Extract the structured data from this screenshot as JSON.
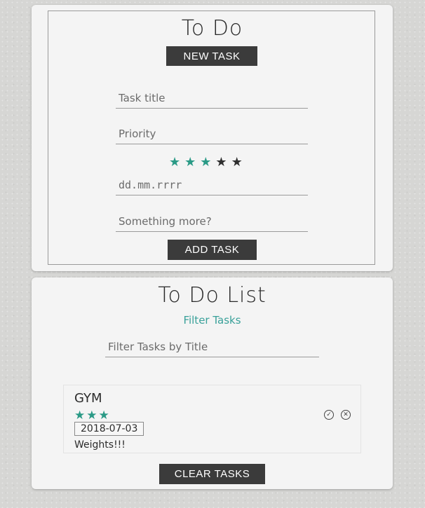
{
  "form_card": {
    "title": "To Do",
    "new_task_label": "NEW TASK",
    "task_title_placeholder": "Task title",
    "priority_placeholder": "Priority",
    "priority_rating": {
      "value": 3,
      "max": 5
    },
    "date_placeholder": "dd.mm.rrrr",
    "notes_placeholder": "Something more?",
    "add_task_label": "ADD TASK",
    "colors": {
      "star_on": "#2a9a86",
      "star_off": "#2f2f2f",
      "button_bg": "#3b3b3b"
    }
  },
  "list_card": {
    "title": "To Do List",
    "filter_link": "Filter Tasks",
    "filter_placeholder": "Filter Tasks by Title",
    "tasks": [
      {
        "title": "GYM",
        "rating": 3,
        "date": "2018-07-03",
        "description": "Weights!!!",
        "complete_icon": "check-circle-icon",
        "delete_icon": "close-circle-icon"
      }
    ],
    "clear_tasks_label": "CLEAR TASKS",
    "colors": {
      "link": "#3aa19a",
      "star": "#2a9a86"
    }
  }
}
